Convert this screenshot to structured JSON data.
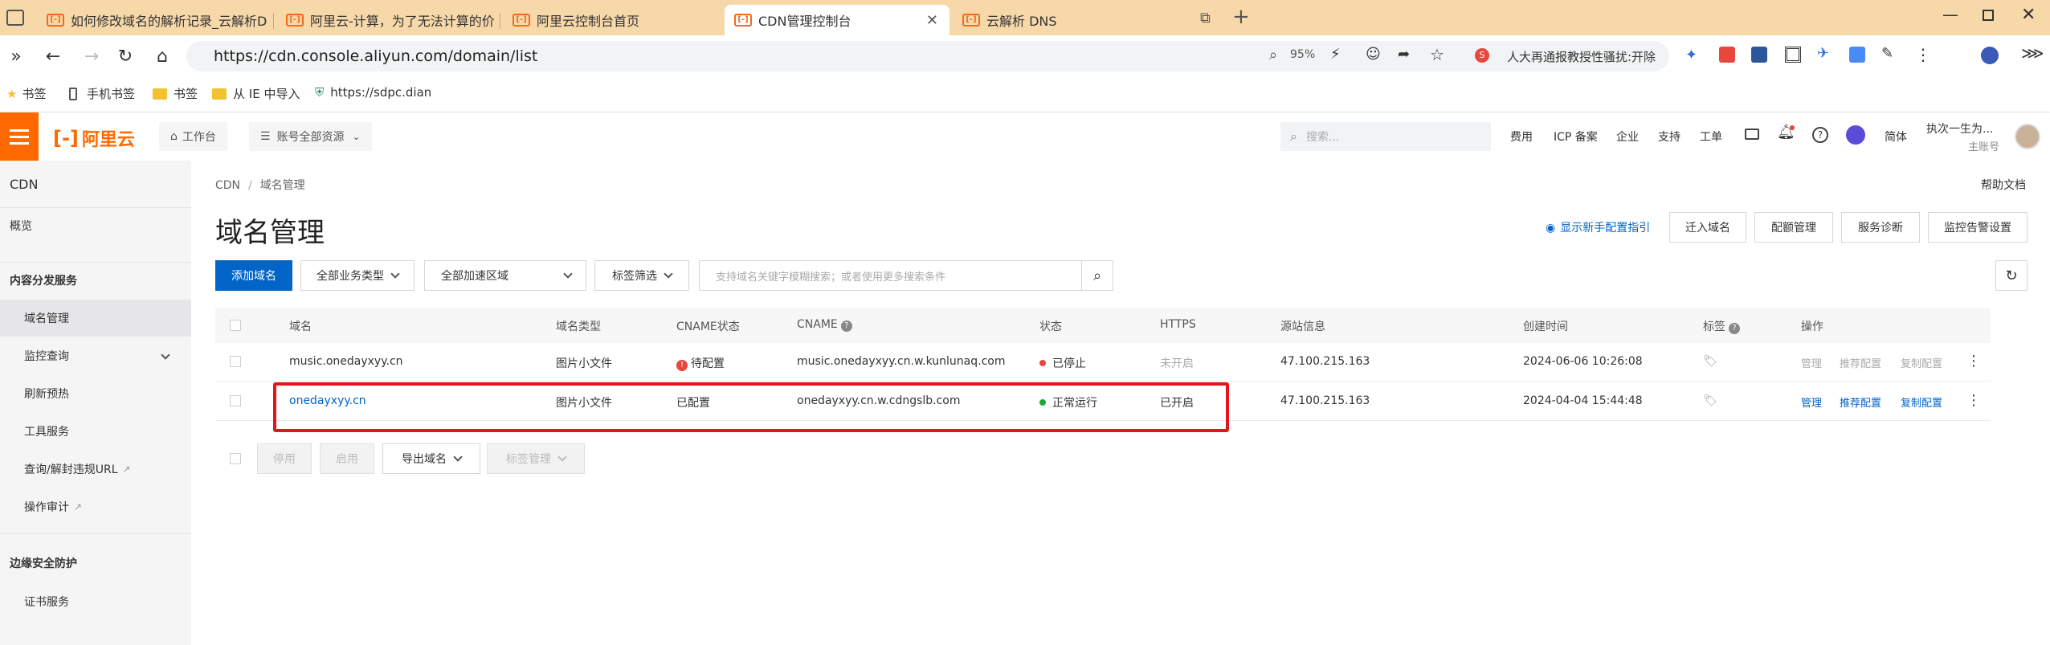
{
  "browser": {
    "tabs": [
      {
        "label": "如何修改域名的解析记录_云解析D"
      },
      {
        "label": "阿里云-计算，为了无法计算的价"
      },
      {
        "label": "阿里云控制台首页"
      },
      {
        "label": "CDN管理控制台",
        "active": true
      },
      {
        "label": "云解析 DNS"
      }
    ],
    "url": "https://cdn.console.aliyun.com/domain/list",
    "zoom": "95%",
    "news_ticker": "人大再通报教授性骚扰:开除",
    "bookmarks": [
      "书签",
      "手机书签",
      "书签",
      "从 IE 中导入",
      "https://sdpc.dian"
    ]
  },
  "topnav": {
    "logo": "阿里云",
    "workspace": "工作台",
    "account_scope": "账号全部资源",
    "search_placeholder": "搜索...",
    "links": [
      "费用",
      "ICP 备案",
      "企业",
      "支持",
      "工单"
    ],
    "lang": "简体",
    "user_name": "执次一生为...",
    "user_role": "主账号"
  },
  "sidebar": {
    "title": "CDN",
    "overview": "概览",
    "section1": "内容分发服务",
    "items1": [
      "域名管理",
      "监控查询",
      "刷新预热",
      "工具服务",
      "查询/解封违规URL",
      "操作审计"
    ],
    "section2": "边缘安全防护",
    "items2": [
      "证书服务"
    ]
  },
  "main": {
    "breadcrumb_root": "CDN",
    "breadcrumb_current": "域名管理",
    "page_title": "域名管理",
    "help": "帮助文档",
    "guide_link": "显示新手配置指引",
    "top_buttons": [
      "迁入域名",
      "配额管理",
      "服务诊断",
      "监控告警设置"
    ],
    "add_domain": "添加域名",
    "filter_business": "全部业务类型",
    "filter_region": "全部加速区域",
    "filter_tag": "标签筛选",
    "search_placeholder": "支持域名关键字模糊搜索；或者使用更多搜索条件",
    "columns": [
      "域名",
      "域名类型",
      "CNAME状态",
      "CNAME",
      "状态",
      "HTTPS",
      "源站信息",
      "创建时间",
      "标签",
      "操作"
    ],
    "rows": [
      {
        "domain": "music.onedayxyy.cn",
        "type": "图片小文件",
        "cname_status": "待配置",
        "cname": "music.onedayxyy.cn.w.kunlunaq.com",
        "status": "已停止",
        "status_color": "#e8473e",
        "https": "未开启",
        "origin": "47.100.215.163",
        "created": "2024-06-06 10:26:08",
        "actions": [
          "管理",
          "推荐配置",
          "复制配置"
        ],
        "actions_enabled": false
      },
      {
        "domain": "onedayxyy.cn",
        "type": "图片小文件",
        "cname_status": "已配置",
        "cname": "onedayxyy.cn.w.cdngslb.com",
        "status": "正常运行",
        "status_color": "#22a63a",
        "https": "已开启",
        "origin": "47.100.215.163",
        "created": "2024-04-04 15:44:48",
        "actions": [
          "管理",
          "推荐配置",
          "复制配置"
        ],
        "actions_enabled": true
      }
    ],
    "bulk": [
      "停用",
      "启用",
      "导出域名",
      "标签管理"
    ]
  }
}
